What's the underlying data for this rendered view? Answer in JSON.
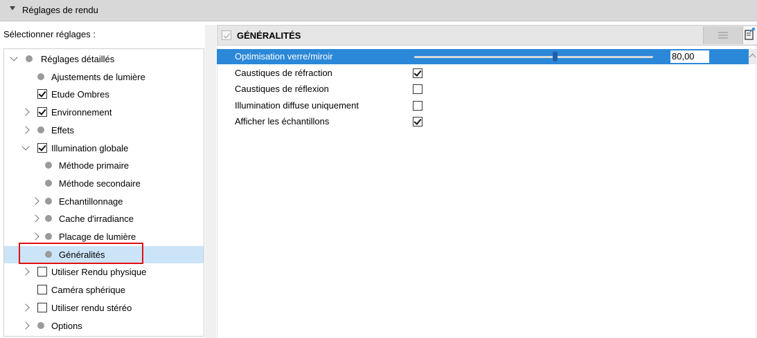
{
  "panel": {
    "title": "Réglages de rendu"
  },
  "left": {
    "caption": "Sélectionner réglages :"
  },
  "tree": [
    {
      "label": "Réglages détaillés",
      "indent": 0,
      "expander": "down",
      "marker": "dot",
      "selected": false
    },
    {
      "label": "Ajustements de lumière",
      "indent": 1,
      "expander": "none",
      "marker": "dot",
      "selected": false
    },
    {
      "label": "Etude Ombres",
      "indent": 1,
      "expander": "none",
      "marker": "checked",
      "selected": false
    },
    {
      "label": "Environnement",
      "indent": 1,
      "expander": "right",
      "marker": "checked",
      "selected": false
    },
    {
      "label": "Effets",
      "indent": 1,
      "expander": "right",
      "marker": "dot",
      "selected": false
    },
    {
      "label": "Illumination globale",
      "indent": 1,
      "expander": "down",
      "marker": "checked",
      "selected": false
    },
    {
      "label": "Méthode primaire",
      "indent": 2,
      "expander": "none",
      "marker": "dot",
      "selected": false
    },
    {
      "label": "Méthode secondaire",
      "indent": 2,
      "expander": "none",
      "marker": "dot",
      "selected": false
    },
    {
      "label": "Echantillonnage",
      "indent": 2,
      "expander": "right",
      "marker": "dot",
      "selected": false
    },
    {
      "label": "Cache d'irradiance",
      "indent": 2,
      "expander": "right",
      "marker": "dot",
      "selected": false
    },
    {
      "label": "Placage de lumière",
      "indent": 2,
      "expander": "right",
      "marker": "dot",
      "selected": false
    },
    {
      "label": "Généralités",
      "indent": 2,
      "expander": "none",
      "marker": "dot",
      "selected": true
    },
    {
      "label": "Utiliser Rendu physique",
      "indent": 1,
      "expander": "right",
      "marker": "unchecked",
      "selected": false
    },
    {
      "label": "Caméra sphérique",
      "indent": 1,
      "expander": "none",
      "marker": "unchecked",
      "selected": false
    },
    {
      "label": "Utiliser rendu stéréo",
      "indent": 1,
      "expander": "right",
      "marker": "unchecked",
      "selected": false
    },
    {
      "label": "Options",
      "indent": 1,
      "expander": "right",
      "marker": "dot",
      "selected": false
    }
  ],
  "right": {
    "header_title": "GÉNÉRALITÉS",
    "settings": [
      {
        "label": "Optimisation verre/miroir",
        "type": "slider",
        "value": "80,00",
        "fraction": 0.58,
        "selected": true
      },
      {
        "label": "Caustiques  de réfraction",
        "type": "checkbox",
        "checked": true
      },
      {
        "label": "Caustiques de réflexion",
        "type": "checkbox",
        "checked": false
      },
      {
        "label": "Illumination diffuse uniquement",
        "type": "checkbox",
        "checked": false
      },
      {
        "label": "Afficher les échantillons",
        "type": "checkbox",
        "checked": true
      }
    ]
  },
  "colors": {
    "selection": "#2b88d8",
    "tree_selection": "#cce4f7",
    "highlight_box": "#e01010"
  }
}
